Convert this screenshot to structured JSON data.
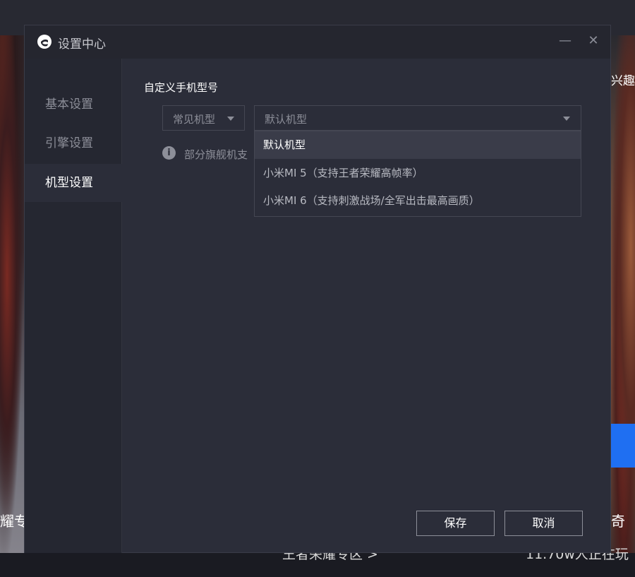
{
  "background": {
    "right_top_text": "兴趣",
    "left_bottom_text": "耀专",
    "right_bottom_text": "奇",
    "bottom_center_text": "王者荣耀专区 >",
    "bottom_right_text": "11.70w人正在玩"
  },
  "dialog": {
    "title": "设置中心",
    "minimize_symbol": "—",
    "close_symbol": "✕"
  },
  "sidebar": {
    "items": [
      {
        "label": "基本设置"
      },
      {
        "label": "引擎设置"
      },
      {
        "label": "机型设置"
      }
    ],
    "active_index": 2
  },
  "main": {
    "section_title": "自定义手机型号",
    "category_select": {
      "value": "常见机型"
    },
    "model_select": {
      "value": "默认机型"
    },
    "info_icon_glyph": "i",
    "info_text": "部分旗舰机支"
  },
  "dropdown": {
    "options": [
      {
        "label": "默认机型"
      },
      {
        "label": "小米MI 5（支持王者荣耀高帧率）"
      },
      {
        "label": "小米MI 6（支持刺激战场/全军出击最高画质）"
      }
    ],
    "selected_index": 0
  },
  "footer": {
    "save_label": "保存",
    "cancel_label": "取消"
  },
  "colors": {
    "dialog_bg": "#2b2d39",
    "sidebar_bg": "#252731",
    "accent_blue": "#1f6ff2"
  }
}
